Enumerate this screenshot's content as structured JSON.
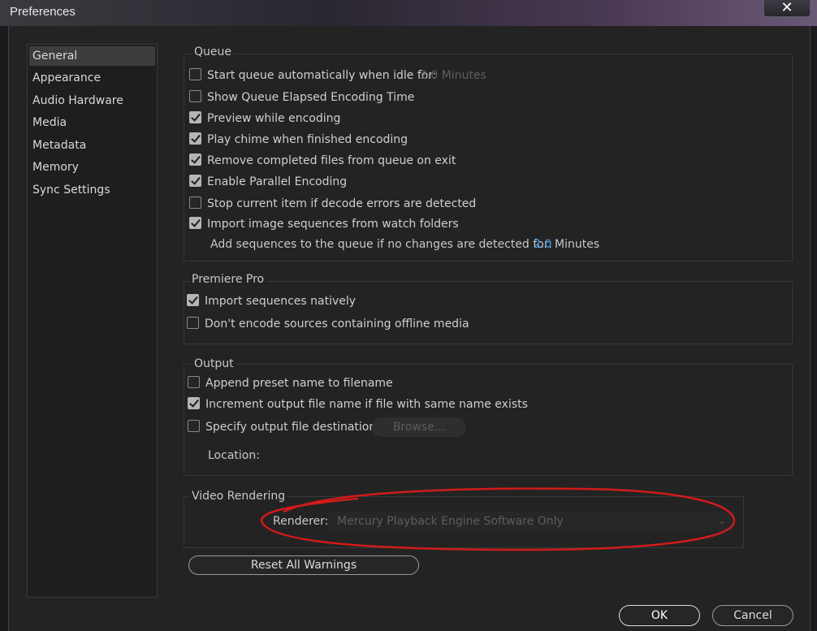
{
  "window": {
    "title": "Preferences",
    "close_glyph": "✕"
  },
  "sidebar": {
    "items": [
      {
        "label": "General",
        "selected": true
      },
      {
        "label": "Appearance"
      },
      {
        "label": "Audio Hardware"
      },
      {
        "label": "Media"
      },
      {
        "label": "Metadata"
      },
      {
        "label": "Memory"
      },
      {
        "label": "Sync Settings"
      }
    ]
  },
  "queue": {
    "title": "Queue",
    "start_auto": {
      "label": "Start queue automatically when idle for:",
      "checked": false,
      "value": "2.0 Minutes"
    },
    "show_elapsed": {
      "label": "Show Queue Elapsed Encoding Time",
      "checked": false
    },
    "preview": {
      "label": "Preview while encoding",
      "checked": true
    },
    "chime": {
      "label": "Play chime when finished encoding",
      "checked": true
    },
    "remove_completed": {
      "label": "Remove completed files from queue on exit",
      "checked": true
    },
    "parallel": {
      "label": "Enable Parallel Encoding",
      "checked": true
    },
    "stop_decode": {
      "label": "Stop current item if decode errors are detected",
      "checked": false
    },
    "import_sequences": {
      "label": "Import image sequences from watch folders",
      "checked": true
    },
    "add_sequences": {
      "label": "Add sequences to the queue if no changes are detected for:",
      "value": "2.0",
      "unit": "Minutes"
    }
  },
  "premiere": {
    "title": "Premiere Pro",
    "import_native": {
      "label": "Import sequences natively",
      "checked": true
    },
    "dont_encode": {
      "label": "Don't encode sources containing offline media",
      "checked": false
    }
  },
  "output": {
    "title": "Output",
    "append_preset": {
      "label": "Append preset name to filename",
      "checked": false
    },
    "increment": {
      "label": "Increment output file name if file with same name exists",
      "checked": true
    },
    "specify_dest": {
      "label": "Specify output file destination:",
      "checked": false
    },
    "browse_label": "Browse...",
    "location_label": "Location:"
  },
  "video": {
    "title": "Video Rendering",
    "renderer_label": "Renderer:",
    "renderer_value": "Mercury Playback Engine Software Only",
    "annotation_color": "#d11a1a"
  },
  "buttons": {
    "reset": "Reset All Warnings",
    "ok": "OK",
    "cancel": "Cancel"
  },
  "icons": {
    "check": "checkmark-icon",
    "dropdown": "chevron-down-icon",
    "close": "close-icon"
  }
}
